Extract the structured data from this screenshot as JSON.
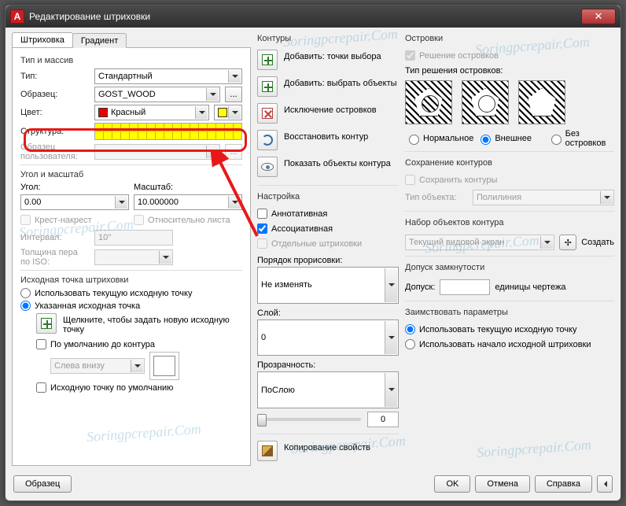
{
  "window": {
    "title": "Редактирование штриховки",
    "logo": "A"
  },
  "tabs": {
    "hatch": "Штриховка",
    "gradient": "Градиент"
  },
  "col1": {
    "group1": "Тип и массив",
    "type_lbl": "Тип:",
    "type_val": "Стандартный",
    "pattern_lbl": "Образец:",
    "pattern_val": "GOST_WOOD",
    "pattern_btn": "...",
    "color_lbl": "Цвет:",
    "color_val": "Красный",
    "struct_lbl": "Структура:",
    "userpat_lbl": "Образец пользователя:",
    "group2": "Угол и масштаб",
    "angle_lbl": "Угол:",
    "angle_val": "0.00",
    "scale_lbl": "Масштаб:",
    "scale_val": "10.000000",
    "cross_cb": "Крест-накрест",
    "relsheet_cb": "Относительно листа",
    "spacing_lbl": "Интервал:",
    "spacing_val": "10''",
    "isopen_lbl": "Толщина пера по ISO:",
    "group3": "Исходная точка штриховки",
    "use_current": "Использовать текущую исходную точку",
    "specified": "Указанная исходная точка",
    "click_hint": "Щелкните, чтобы задать новую исходную точку",
    "default_contour": "По умолчанию до контура",
    "pos_combo": "Слева внизу",
    "save_default": "Исходную точку по умолчанию",
    "sample_btn": "Образец"
  },
  "col2": {
    "group_contours": "Контуры",
    "add_points": "Добавить: точки выбора",
    "add_select": "Добавить: выбрать объекты",
    "exclude": "Исключение островков",
    "restore": "Восстановить контур",
    "show": "Показать объекты контура",
    "group_settings": "Настройка",
    "annot_cb": "Аннотативная",
    "assoc_cb": "Ассоциативная",
    "separate_cb": "Отдельные штриховки",
    "draw_order_lbl": "Порядок прорисовки:",
    "draw_order_val": "Не изменять",
    "layer_lbl": "Слой:",
    "layer_val": "0",
    "transp_lbl": "Прозрачность:",
    "transp_val": "ПоСлою",
    "slider_val": "0",
    "copy_props": "Копирование свойств"
  },
  "col3": {
    "group_islands": "Островки",
    "detect_cb": "Решение островков",
    "style_lbl": "Тип решения островков:",
    "opt_normal": "Нормальное",
    "opt_outer": "Внешнее",
    "opt_none": "Без островков",
    "group_retain": "Сохранение контуров",
    "retain_cb": "Сохранить контуры",
    "objtype_lbl": "Тип объекта:",
    "objtype_val": "Полилиния",
    "group_bset": "Набор объектов контура",
    "bset_val": "Текущий видовой экран",
    "bset_create": "Создать",
    "group_tol": "Допуск замкнутости",
    "tol_lbl": "Допуск:",
    "tol_units": "единицы чертежа",
    "group_inherit": "Заимствовать параметры",
    "inh_current": "Использовать текущую исходную точку",
    "inh_source": "Использовать начало исходной штриховки"
  },
  "footer": {
    "ok": "OK",
    "cancel": "Отмена",
    "help": "Справка"
  },
  "watermark": "Soringpcrepair.Com"
}
